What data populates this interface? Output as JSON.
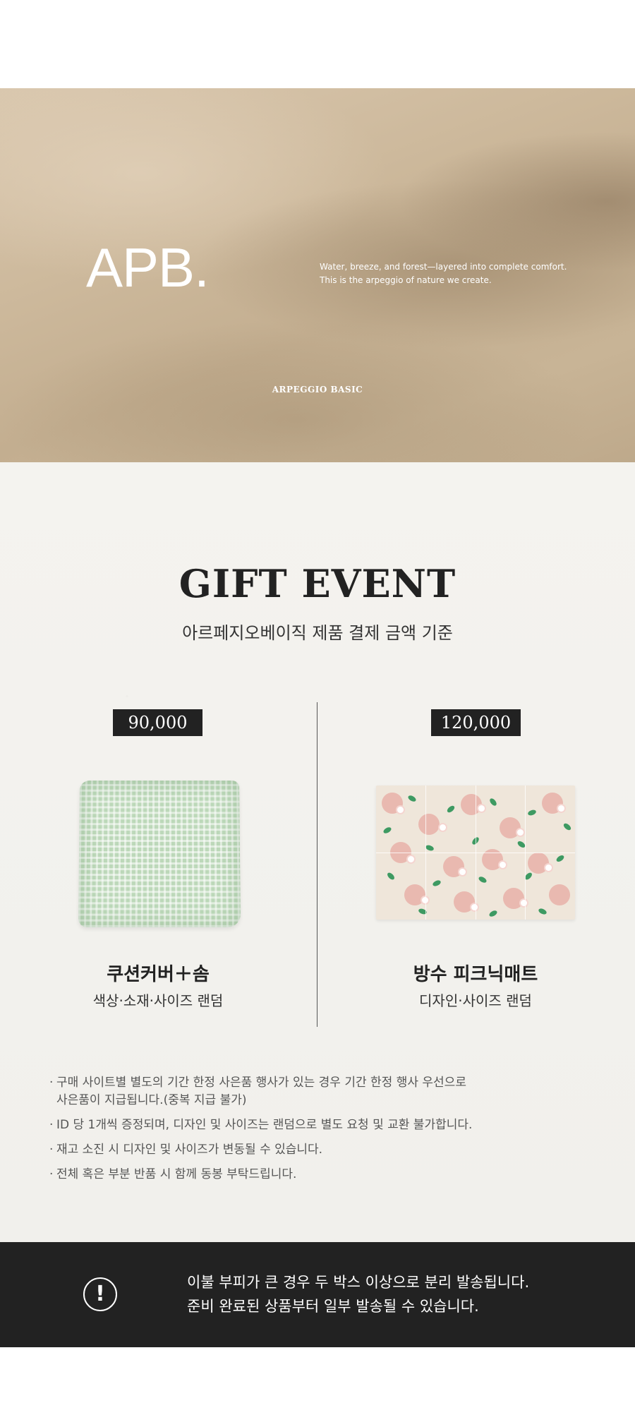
{
  "hero": {
    "logo": "APB.",
    "tagline_line1": "Water, breeze, and forest—layered into complete comfort.",
    "tagline_line2": "This is the arpeggio of nature we create.",
    "brand": "ARPEGGIO BASIC"
  },
  "gift": {
    "title": "GIFT EVENT",
    "subtitle": "아르페지오베이직 제품 결제 금액 기준",
    "items": [
      {
        "price": "90,000",
        "name": "쿠션커버＋솜",
        "description": "색상·소재·사이즈 랜덤",
        "image_icon": "cushion-image"
      },
      {
        "price": "120,000",
        "name": "방수 피크닉매트",
        "description": "디자인·사이즈 랜덤",
        "image_icon": "picnic-mat-image"
      }
    ],
    "notes": [
      "구매 사이트별 별도의 기간 한정 사은품 행사가 있는 경우 기간 한정 행사 우선으로",
      "사은품이 지급됩니다.(중복 지급 불가)",
      "ID 당 1개씩 증정되며, 디자인 및 사이즈는 랜덤으로 별도 요청 및 교환 불가합니다.",
      "재고 소진 시 디자인 및 사이즈가 변동될 수 있습니다.",
      "전체 혹은 부분 반품 시 함께 동봉 부탁드립니다."
    ]
  },
  "notice": {
    "icon": "exclamation-circle-icon",
    "icon_glyph": "!",
    "line1": "이불 부피가 큰 경우 두 박스 이상으로 분리 발송됩니다.",
    "line2": "준비 완료된 상품부터 일부 발송될 수 있습니다."
  },
  "colors": {
    "dark": "#222222",
    "hero_beige": "#cdb99c",
    "paper": "#f3f2ee"
  }
}
